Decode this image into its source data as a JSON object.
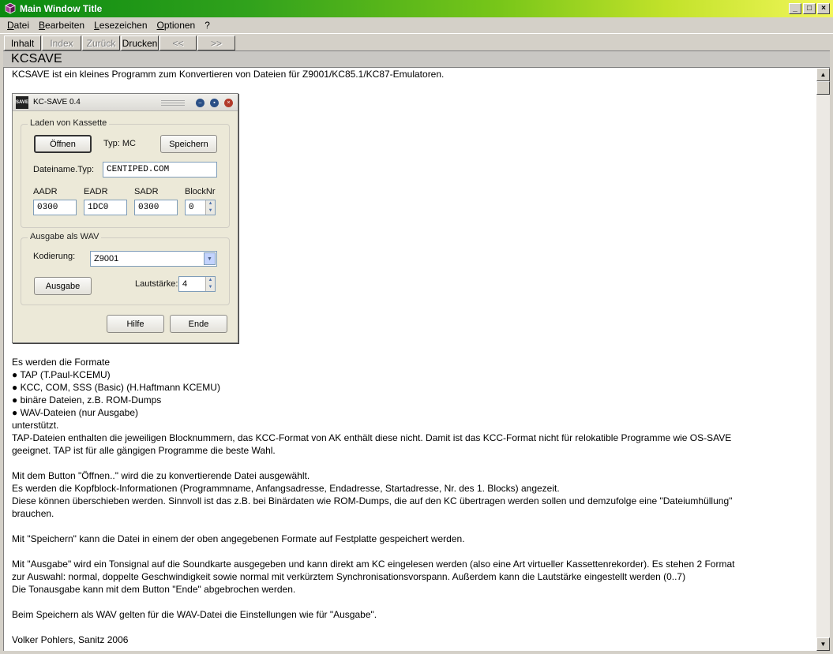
{
  "window": {
    "title": "Main Window Title",
    "controls": {
      "minimize": "_",
      "maximize": "□",
      "close": "×"
    }
  },
  "menu": [
    "Datei",
    "Bearbeiten",
    "Lesezeichen",
    "Optionen",
    "?"
  ],
  "toolbar": {
    "inhalt": "Inhalt",
    "index": "Index",
    "zurueck": "Zurück",
    "drucken": "Drucken",
    "back_history": "<<",
    "forward_history": ">>"
  },
  "topic": {
    "title": "KCSAVE"
  },
  "content": {
    "intro": "KCSAVE ist ein kleines Programm zum Konvertieren von Dateien für Z9001/KC85.1/KC87-Emulatoren.",
    "formats_intro": "Es werden die Formate",
    "formats": [
      "● TAP (T.Paul-KCEMU)",
      "● KCC, COM, SSS (Basic) (H.Haftmann KCEMU)",
      "● binäre Dateien, z.B. ROM-Dumps",
      "● WAV-Dateien (nur Ausgabe)"
    ],
    "supported": "unterstützt.",
    "tap_note_1": "TAP-Dateien enthalten die jeweiligen Blocknummern, das KCC-Format von AK enthält diese nicht. Damit ist das KCC-Format nicht für relokatible Programme wie OS-SAVE",
    "tap_note_2": "geeignet. TAP ist für alle gängigen Programme die beste Wahl.",
    "open_1": "Mit dem Button \"Öffnen..\" wird die zu konvertierende Datei ausgewählt.",
    "open_2": "Es werden die Kopfblock-Informationen (Programmname, Anfangsadresse, Endadresse, Startadresse, Nr. des 1. Blocks) angezeit.",
    "open_3": "Diese können überschieben werden. Sinnvoll ist das z.B. bei Binärdaten wie ROM-Dumps, die auf den KC übertragen werden sollen und demzufolge eine \"Dateiumhüllung\"",
    "open_4": "brauchen.",
    "save": "Mit \"Speichern\" kann die Datei in einem der oben angegebenen Formate auf Festplatte gespeichert werden.",
    "output_1": "Mit \"Ausgabe\" wird ein Tonsignal auf die Soundkarte ausgegeben und kann direkt am KC eingelesen werden (also eine Art virtueller Kassettenrekorder). Es stehen 2 Format",
    "output_2": "zur Auswahl: normal, doppelte Geschwindigkeit sowie normal mit verkürztem Synchronisationsvorspann. Außerdem kann die Lautstärke eingestellt werden (0..7)",
    "output_3": "Die Tonausgabe kann mit dem Button \"Ende\" abgebrochen werden.",
    "wav": "Beim Speichern als WAV gelten für die WAV-Datei die Einstellungen wie für \"Ausgabe\".",
    "author": "Volker Pohlers, Sanitz 2006"
  },
  "kcsave_dialog": {
    "title": "KC-SAVE 0.4",
    "logo": "SAVE",
    "group_load": "Laden von Kassette",
    "btn_open": "Öffnen",
    "type_label": "Typ: MC",
    "btn_save": "Speichern",
    "filename_label": "Dateiname.Typ:",
    "filename_value": "CENTIPED.COM",
    "aadr_label": "AADR",
    "eadr_label": "EADR",
    "sadr_label": "SADR",
    "blocknr_label": "BlockNr",
    "aadr_value": "0300",
    "eadr_value": "1DC0",
    "sadr_value": "0300",
    "blocknr_value": "0",
    "group_wav": "Ausgabe als WAV",
    "encoding_label": "Kodierung:",
    "encoding_value": "Z9001",
    "btn_output": "Ausgabe",
    "volume_label": "Lautstärke:",
    "volume_value": "4",
    "btn_help": "Hilfe",
    "btn_end": "Ende"
  }
}
